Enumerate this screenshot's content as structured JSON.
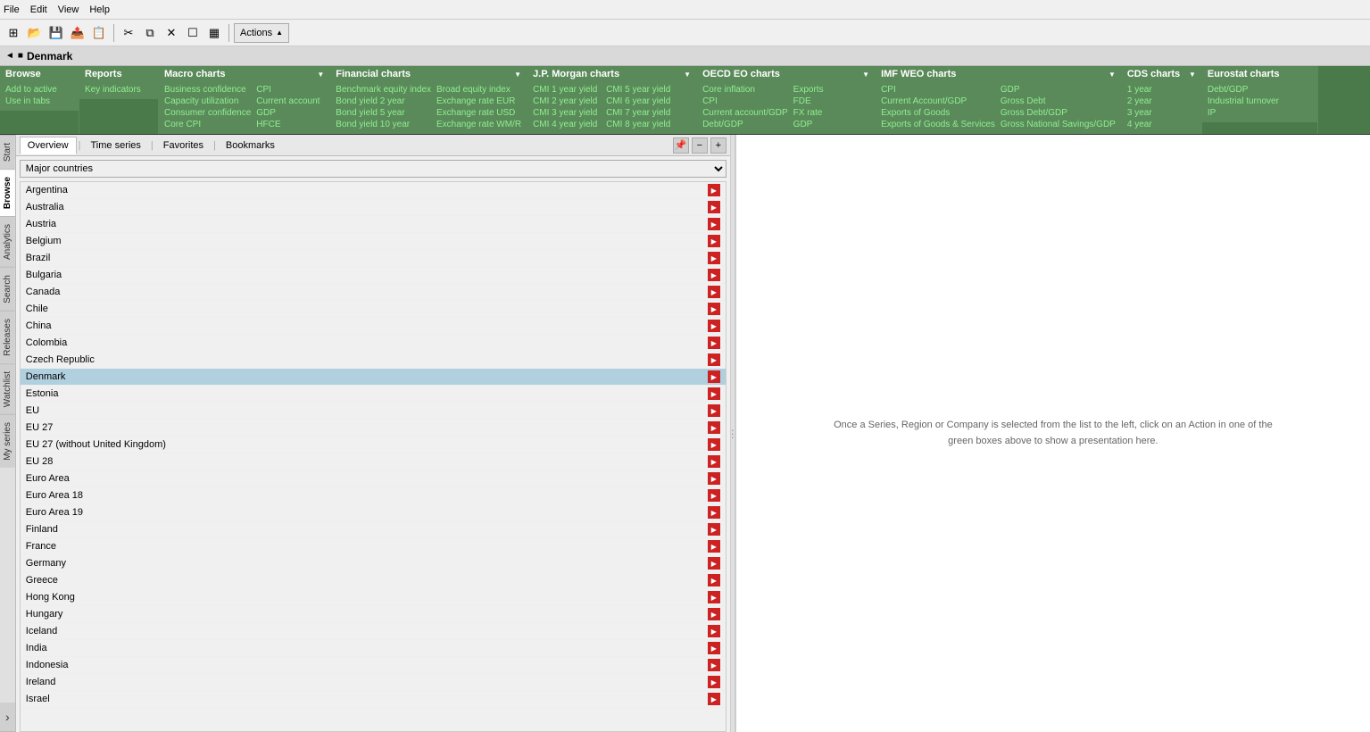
{
  "menubar": {
    "items": [
      "File",
      "Edit",
      "View",
      "Help"
    ]
  },
  "toolbar": {
    "actions_label": "Actions"
  },
  "title": "Denmark",
  "nav_menus": {
    "browse": {
      "label": "Browse",
      "items": [
        "Add to active",
        "Use in tabs"
      ]
    },
    "reports": {
      "label": "Reports",
      "items": [
        "Key indicators"
      ]
    },
    "macro_charts": {
      "label": "Macro charts",
      "col1": [
        "Business confidence",
        "Capacity utilization",
        "Consumer confidence",
        "Core CPI"
      ],
      "col2": [
        "CPI",
        "Current account",
        "GDP",
        "HFCE"
      ]
    },
    "financial_charts": {
      "label": "Financial charts",
      "col1": [
        "Benchmark equity index",
        "Bond yield 2 year",
        "Bond yield 5 year",
        "Bond yield 10 year"
      ],
      "col2": [
        "Broad equity index",
        "Exchange rate EUR",
        "Exchange rate USD",
        "Exchange rate WM/R"
      ]
    },
    "jp_morgan_charts": {
      "label": "J.P. Morgan charts",
      "col1": [
        "CMI 1 year yield",
        "CMI 2 year yield",
        "CMI 3 year yield",
        "CMI 4 year yield"
      ],
      "col2": [
        "CMI 5 year yield",
        "CMI 6 year yield",
        "CMI 7 year yield",
        "CMI 8 year yield"
      ]
    },
    "oecd_eo_charts": {
      "label": "OECD EO charts",
      "col1": [
        "Core inflation",
        "CPI",
        "Current account/GDP",
        "Debt/GDP"
      ],
      "col2": [
        "Exports",
        "FDE",
        "FX rate",
        "GDP"
      ]
    },
    "imf_weo_charts": {
      "label": "IMF WEO charts",
      "col1": [
        "CPI",
        "Current Account/GDP",
        "Exports of Goods",
        "Exports of Goods & Services"
      ],
      "col2": [
        "GDP",
        "Gross Debt",
        "Gross Debt/GDP",
        "Gross National Savings/GDP"
      ]
    },
    "cds_charts": {
      "label": "CDS charts",
      "items": [
        "1 year",
        "2 year",
        "3 year",
        "4 year"
      ]
    },
    "eurostat_charts": {
      "label": "Eurostat charts",
      "items": [
        "Debt/GDP",
        "Industrial turnover",
        "IP"
      ]
    }
  },
  "content_tabs": {
    "tabs": [
      "Overview",
      "Time series",
      "Favorites",
      "Bookmarks"
    ]
  },
  "list_dropdown": {
    "options": [
      "Major countries"
    ],
    "selected": "Major countries"
  },
  "countries": [
    "Argentina",
    "Australia",
    "Austria",
    "Belgium",
    "Brazil",
    "Bulgaria",
    "Canada",
    "Chile",
    "China",
    "Colombia",
    "Czech Republic",
    "Denmark",
    "Estonia",
    "EU",
    "EU 27",
    "EU 27 (without United Kingdom)",
    "EU 28",
    "Euro Area",
    "Euro Area 18",
    "Euro Area 19",
    "Finland",
    "France",
    "Germany",
    "Greece",
    "Hong Kong",
    "Hungary",
    "Iceland",
    "India",
    "Indonesia",
    "Ireland",
    "Israel"
  ],
  "selected_country": "Denmark",
  "right_panel": {
    "info_text": "Once a Series, Region or Company is selected from the list to the left, click on an Action in one of the green boxes above to show a presentation here."
  },
  "sidebar_tabs": [
    "Start",
    "Browse",
    "Analytics",
    "Search",
    "Releases",
    "Watchlist",
    "My series"
  ]
}
